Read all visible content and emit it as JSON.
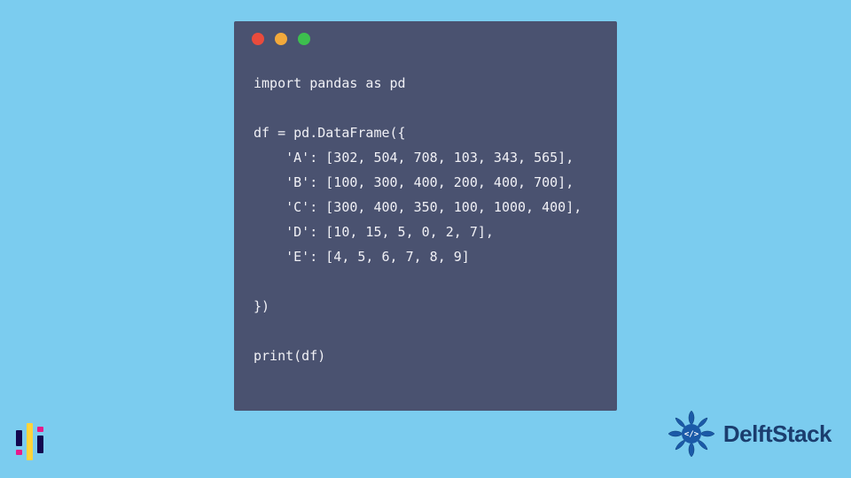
{
  "code": {
    "lines": [
      "import pandas as pd",
      "",
      "df = pd.DataFrame({",
      "    'A': [302, 504, 708, 103, 343, 565],",
      "    'B': [100, 300, 400, 200, 400, 700],",
      "    'C': [300, 400, 350, 100, 1000, 400],",
      "    'D': [10, 15, 5, 0, 2, 7],",
      "    'E': [4, 5, 6, 7, 8, 9]",
      "",
      "})",
      "",
      "print(df)"
    ]
  },
  "brand": {
    "name": "DelftStack"
  },
  "window": {
    "dots": [
      "red",
      "yellow",
      "green"
    ]
  },
  "colors": {
    "bg": "#7bccef",
    "window": "#4a5270",
    "brand_text": "#1b3d6e"
  }
}
